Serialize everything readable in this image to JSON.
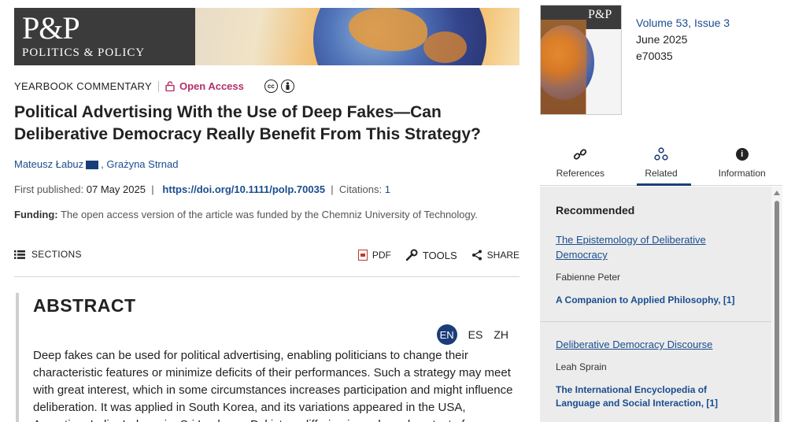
{
  "journal": {
    "logo_big": "P&P",
    "logo_small": "POLITICS & POLICY"
  },
  "article": {
    "kicker": "YEARBOOK COMMENTARY",
    "open_access": "Open Access",
    "title": "Political Advertising With the Use of Deep Fakes—Can Deliberative Democracy Really Benefit From This Strategy?",
    "authors": [
      {
        "name": "Mateusz Łabuz"
      },
      {
        "name": "Grażyna Strnad"
      }
    ],
    "first_published_label": "First published:",
    "first_published": "07 May 2025",
    "doi": "https://doi.org/10.1111/polp.70035",
    "citations_label": "Citations:",
    "citations": "1",
    "funding_label": "Funding:",
    "funding_text": "The open access version of the article was funded by the Chemniz University of Technology."
  },
  "toolbar": {
    "sections": "SECTIONS",
    "pdf": "PDF",
    "tools": "TOOLS",
    "share": "SHARE"
  },
  "abstract": {
    "heading": "ABSTRACT",
    "languages": [
      "EN",
      "ES",
      "ZH"
    ],
    "active_language": "EN",
    "text": "Deep fakes can be used for political advertising, enabling politicians to change their characteristic features or minimize deficits of their performances. Such a strategy may meet with great interest, which in some circumstances increases participation and might influence deliberation. It was applied in South Korea, and its variations appeared in the USA, Argentina, India, Indonesia, Sri Lanka, or Pakistan, differing in scale and context of use."
  },
  "issue": {
    "cover_logo": "P&P",
    "volume": "Volume 53, Issue 3",
    "date": "June 2025",
    "article_id": "e70035"
  },
  "side_tabs": [
    {
      "label": "References",
      "icon": "link-icon"
    },
    {
      "label": "Related",
      "icon": "network-icon"
    },
    {
      "label": "Information",
      "icon": "info-icon"
    }
  ],
  "active_side_tab": "Related",
  "recommended": {
    "heading": "Recommended",
    "items": [
      {
        "title": "The Epistemology of Deliberative Democracy",
        "author": "Fabienne Peter",
        "source": "A Companion to Applied Philosophy, [1]"
      },
      {
        "title": "Deliberative Democracy Discourse",
        "author": "Leah Sprain",
        "source": "The International Encyclopedia of Language and Social Interaction, [1]"
      }
    ]
  },
  "colors": {
    "brand_blue": "#1a3d7a",
    "link_blue": "#1a4d8f",
    "open_access": "#b3306b",
    "panel_bg": "#ececec"
  }
}
